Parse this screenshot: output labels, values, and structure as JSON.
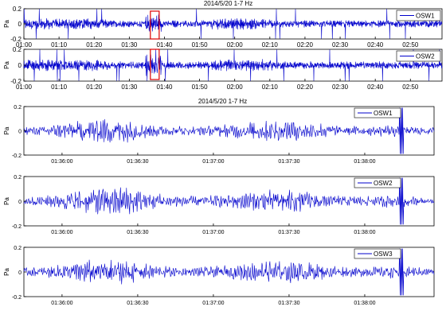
{
  "colors": {
    "trace": "#0000cc",
    "highlight": "#dd0000",
    "axis": "#000000",
    "background": "#ffffff"
  },
  "chart_data": [
    {
      "type": "line",
      "title": "2014/5/20 1-7 Hz",
      "ylabel": "Pa",
      "legend": "OSW1",
      "legend_position": "top-right",
      "x_ticks": [
        "01:00",
        "01:10",
        "01:20",
        "01:30",
        "01:40",
        "01:50",
        "02:00",
        "02:10",
        "02:20",
        "02:30",
        "02:40",
        "02:50"
      ],
      "y_ticks": [
        "-0.2",
        "0",
        "0.2"
      ],
      "ylim": [
        -0.2,
        0.2
      ],
      "xlim_minutes": [
        0,
        119
      ],
      "highlight_window_minutes": [
        36,
        38.5
      ],
      "grid": false
    },
    {
      "type": "line",
      "title": "",
      "ylabel": "Pa",
      "legend": "OSW2",
      "legend_position": "top-right",
      "x_ticks": [
        "01:00",
        "01:10",
        "01:20",
        "01:30",
        "01:40",
        "01:50",
        "02:00",
        "02:10",
        "02:20",
        "02:30",
        "02:40",
        "02:50"
      ],
      "y_ticks": [
        "-0.2",
        "0",
        "0.2"
      ],
      "ylim": [
        -0.2,
        0.2
      ],
      "xlim_minutes": [
        0,
        119
      ],
      "highlight_window_minutes": [
        36,
        38.5
      ],
      "grid": false
    },
    {
      "type": "line",
      "title": "2014/5/20 1-7 Hz",
      "ylabel": "Pa",
      "legend": "OSW1",
      "legend_position": "top-right",
      "x_ticks": [
        "01:36:00",
        "01:36:30",
        "01:37:00",
        "01:37:30",
        "01:38:00"
      ],
      "y_ticks": [
        "-0.2",
        "0",
        "0.2"
      ],
      "ylim": [
        -0.2,
        0.2
      ],
      "grid": false
    },
    {
      "type": "line",
      "title": "",
      "ylabel": "Pa",
      "legend": "OSW2",
      "legend_position": "top-right",
      "x_ticks": [
        "01:36:00",
        "01:36:30",
        "01:37:00",
        "01:37:30",
        "01:38:00"
      ],
      "y_ticks": [
        "-0.2",
        "0",
        "0.2"
      ],
      "ylim": [
        -0.2,
        0.2
      ],
      "grid": false
    },
    {
      "type": "line",
      "title": "",
      "ylabel": "Pa",
      "legend": "OSW3",
      "legend_position": "top-right",
      "x_ticks": [
        "01:36:00",
        "01:36:30",
        "01:37:00",
        "01:37:30",
        "01:38:00"
      ],
      "y_ticks": [
        "-0.2",
        "0",
        "0.2"
      ],
      "ylim": [
        -0.2,
        0.2
      ],
      "grid": false
    }
  ]
}
